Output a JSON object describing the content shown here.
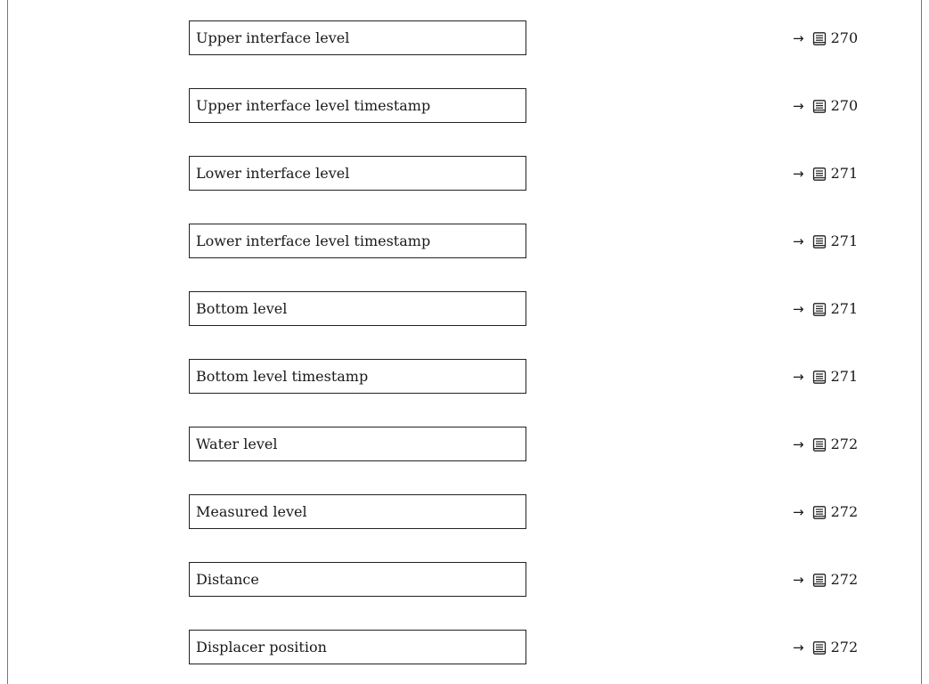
{
  "parameters": [
    {
      "label": "Upper interface level",
      "arrow": "→",
      "page": "270"
    },
    {
      "label": "Upper interface level timestamp",
      "arrow": "→",
      "page": "270"
    },
    {
      "label": "Lower interface level",
      "arrow": "→",
      "page": "271"
    },
    {
      "label": "Lower interface level timestamp",
      "arrow": "→",
      "page": "271"
    },
    {
      "label": "Bottom level",
      "arrow": "→",
      "page": "271"
    },
    {
      "label": "Bottom level timestamp",
      "arrow": "→",
      "page": "271"
    },
    {
      "label": "Water level",
      "arrow": "→",
      "page": "272"
    },
    {
      "label": "Measured level",
      "arrow": "→",
      "page": "272"
    },
    {
      "label": "Distance",
      "arrow": "→",
      "page": "272"
    },
    {
      "label": "Displacer position",
      "arrow": "→",
      "page": "272"
    }
  ],
  "icons": {
    "reference": "book-icon"
  }
}
